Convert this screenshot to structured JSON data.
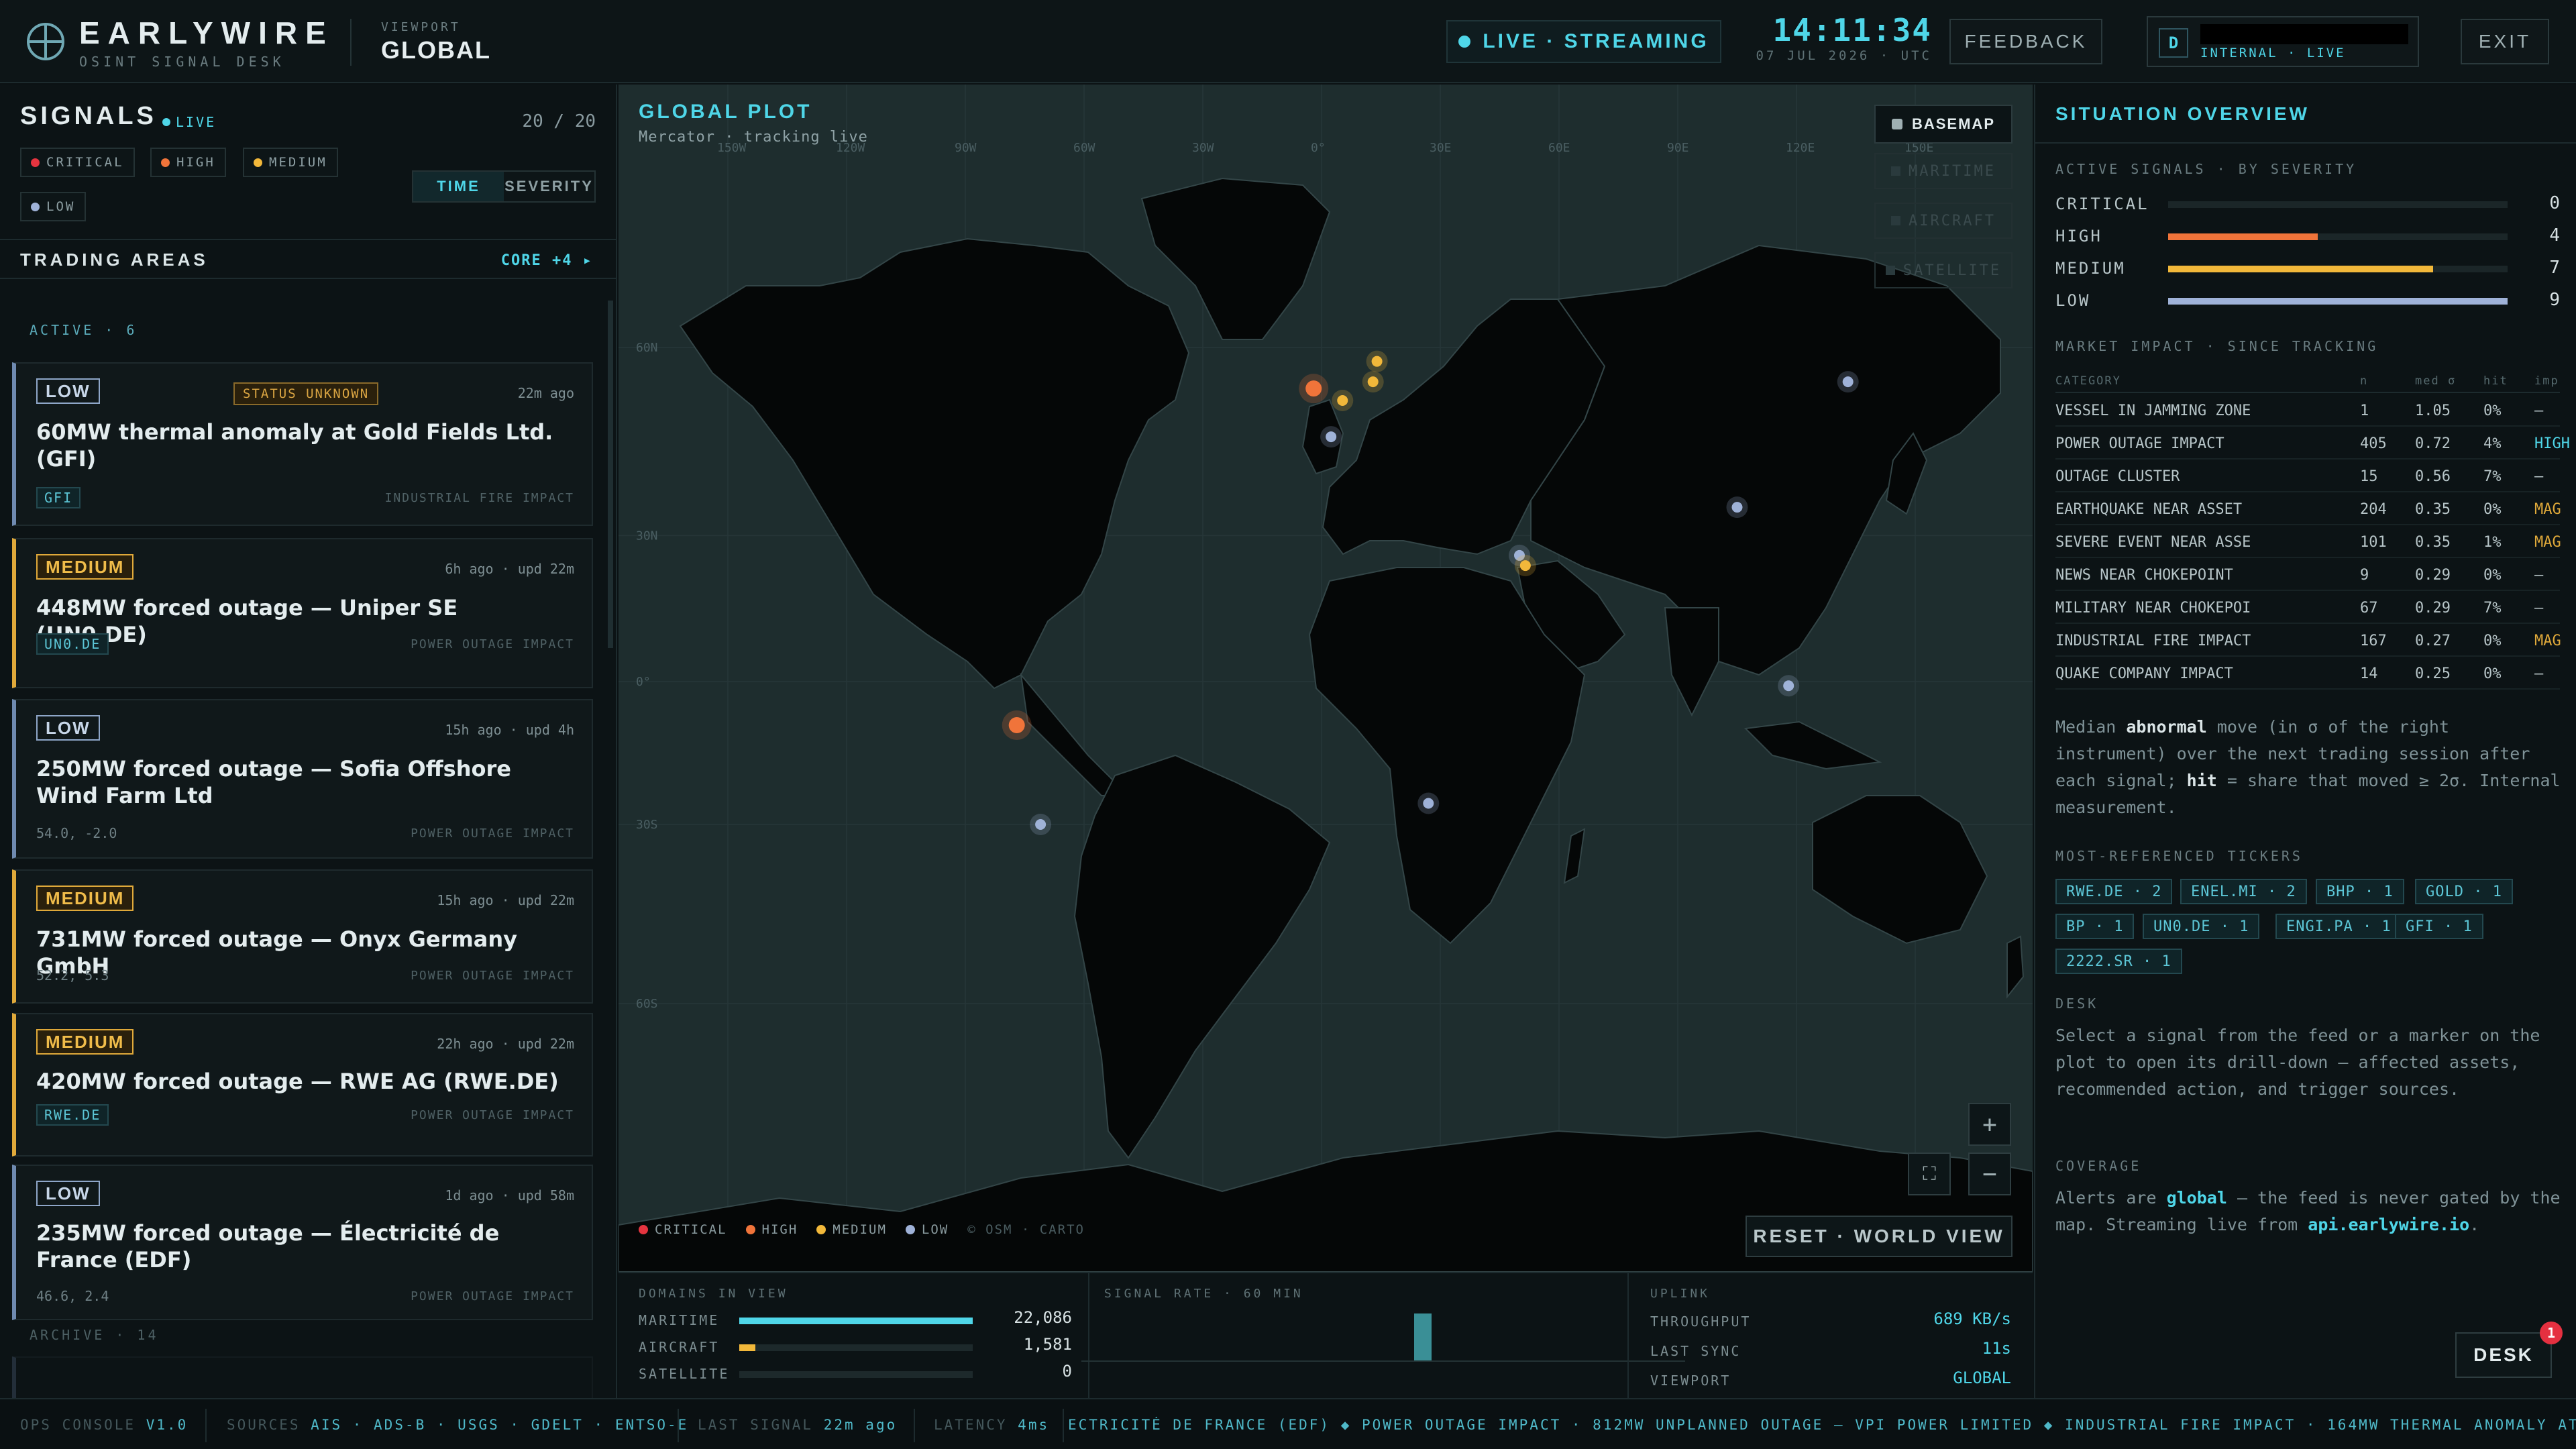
{
  "header": {
    "brand": "EARLYWIRE",
    "brand_sub": "OSINT SIGNAL DESK",
    "viewport_label": "VIEWPORT",
    "viewport_value": "GLOBAL",
    "live_label": "LIVE · STREAMING",
    "clock": "14:11:34",
    "date": "07 JUL 2026 · UTC",
    "feedback_label": "FEEDBACK",
    "user_initial": "D",
    "user_status": "INTERNAL · LIVE",
    "exit_label": "EXIT"
  },
  "colors": {
    "critical": "#e5343f",
    "high": "#f0743a",
    "medium": "#f2b83a",
    "low": "#9fb2d8",
    "accent": "#4fd6e8"
  },
  "signals": {
    "title": "SIGNALS",
    "live": "LIVE",
    "count": "20 / 20",
    "filters": [
      "CRITICAL",
      "HIGH",
      "MEDIUM",
      "LOW"
    ],
    "sort": [
      "TIME",
      "SEVERITY"
    ],
    "trading_title": "TRADING AREAS",
    "trading_link": "CORE +4 ▸",
    "active_label": "ACTIVE · 6",
    "archive_label": "ARCHIVE · 14",
    "cards": [
      {
        "severity": "LOW",
        "status": "STATUS UNKNOWN",
        "time": "22m ago",
        "title": "60MW thermal anomaly at Gold Fields Ltd. (GFI)",
        "ticker": "GFI",
        "type": "INDUSTRIAL FIRE IMPACT"
      },
      {
        "severity": "MEDIUM",
        "time": "6h ago · upd 22m",
        "title": "448MW forced outage — Uniper SE (UN0.DE)",
        "ticker": "UN0.DE",
        "type": "POWER OUTAGE IMPACT"
      },
      {
        "severity": "LOW",
        "time": "15h ago · upd 4h",
        "title": "250MW forced outage — Sofia Offshore Wind Farm Ltd",
        "coord": "54.0, -2.0",
        "type": "POWER OUTAGE IMPACT"
      },
      {
        "severity": "MEDIUM",
        "time": "15h ago · upd 22m",
        "title": "731MW forced outage — Onyx Germany GmbH",
        "coord": "52.2, 5.3",
        "type": "POWER OUTAGE IMPACT"
      },
      {
        "severity": "MEDIUM",
        "time": "22h ago · upd 22m",
        "title": "420MW forced outage — RWE AG (RWE.DE)",
        "ticker": "RWE.DE",
        "type": "POWER OUTAGE IMPACT"
      },
      {
        "severity": "LOW",
        "time": "1d ago · upd 58m",
        "title": "235MW forced outage — Électricité de France (EDF)",
        "coord": "46.6, 2.4",
        "type": "POWER OUTAGE IMPACT"
      }
    ]
  },
  "map": {
    "title": "GLOBAL PLOT",
    "subtitle": "Mercator · tracking live",
    "basemap_label": "BASEMAP",
    "layers": [
      "MARITIME",
      "AIRCRAFT",
      "SATELLITE"
    ],
    "lon_labels": [
      "150W",
      "120W",
      "90W",
      "60W",
      "30W",
      "0°",
      "30E",
      "60E",
      "90E",
      "120E",
      "150E"
    ],
    "lat_labels": [
      "60N",
      "30N",
      "0°",
      "30S",
      "60S"
    ],
    "reset_label": "RESET · WORLD VIEW",
    "zoom_in": "+",
    "zoom_out": "−",
    "legend": [
      "CRITICAL",
      "HIGH",
      "MEDIUM",
      "LOW",
      "© OSM · CARTO"
    ],
    "markers": [
      {
        "lon": -2.0,
        "lat": 54.0,
        "severity": "high"
      },
      {
        "lon": 5.3,
        "lat": 52.2,
        "severity": "medium"
      },
      {
        "lon": 13.0,
        "lat": 55.0,
        "severity": "medium"
      },
      {
        "lon": 14.0,
        "lat": 58.0,
        "severity": "medium"
      },
      {
        "lon": 2.4,
        "lat": 46.6,
        "severity": "low"
      },
      {
        "lon": 50.0,
        "lat": 26.4,
        "severity": "low"
      },
      {
        "lon": 51.5,
        "lat": 24.5,
        "severity": "medium"
      },
      {
        "lon": 105.0,
        "lat": 35.0,
        "severity": "low"
      },
      {
        "lon": 133.0,
        "lat": 55.0,
        "severity": "low"
      },
      {
        "lon": 118.0,
        "lat": -1.0,
        "severity": "low"
      },
      {
        "lon": 27.0,
        "lat": -26.0,
        "severity": "low"
      },
      {
        "lon": -71.0,
        "lat": -30.0,
        "severity": "low"
      },
      {
        "lon": -77.0,
        "lat": -10.0,
        "severity": "high"
      }
    ]
  },
  "domains": {
    "title": "DOMAINS IN VIEW",
    "rows": [
      {
        "label": "MARITIME",
        "value": "22,086",
        "fraction": 1.0
      },
      {
        "label": "AIRCRAFT",
        "value": "1,581",
        "fraction": 0.07
      },
      {
        "label": "SATELLITE",
        "value": "0",
        "fraction": 0.0
      }
    ],
    "rate_title": "SIGNAL RATE · 60 MIN"
  },
  "uplink": {
    "title": "UPLINK",
    "rows": [
      {
        "label": "THROUGHPUT",
        "value": "689 KB/s"
      },
      {
        "label": "LAST SYNC",
        "value": "11s"
      },
      {
        "label": "VIEWPORT",
        "value": "GLOBAL"
      }
    ]
  },
  "overview": {
    "title": "SITUATION OVERVIEW",
    "severity_title": "ACTIVE SIGNALS · BY SEVERITY",
    "severity": [
      {
        "label": "CRITICAL",
        "count": 0,
        "fraction": 0.0
      },
      {
        "label": "HIGH",
        "count": 4,
        "fraction": 0.44
      },
      {
        "label": "MEDIUM",
        "count": 7,
        "fraction": 0.78
      },
      {
        "label": "LOW",
        "count": 9,
        "fraction": 1.0
      }
    ],
    "impact_title": "MARKET IMPACT · SINCE TRACKING",
    "impact_headers": [
      "CATEGORY",
      "n",
      "med σ",
      "hit",
      "imp"
    ],
    "impact_rows": [
      [
        "VESSEL IN JAMMING ZONE",
        "1",
        "1.05",
        "0%",
        "—"
      ],
      [
        "POWER OUTAGE IMPACT",
        "405",
        "0.72",
        "4%",
        "HIGH"
      ],
      [
        "OUTAGE CLUSTER",
        "15",
        "0.56",
        "7%",
        "—"
      ],
      [
        "EARTHQUAKE NEAR ASSET",
        "204",
        "0.35",
        "0%",
        "MAG"
      ],
      [
        "SEVERE EVENT NEAR ASSE",
        "101",
        "0.35",
        "1%",
        "MAG"
      ],
      [
        "NEWS NEAR CHOKEPOINT",
        "9",
        "0.29",
        "0%",
        "—"
      ],
      [
        "MILITARY NEAR CHOKEPOI",
        "67",
        "0.29",
        "7%",
        "—"
      ],
      [
        "INDUSTRIAL FIRE IMPACT",
        "167",
        "0.27",
        "0%",
        "MAG"
      ],
      [
        "QUAKE COMPANY IMPACT",
        "14",
        "0.25",
        "0%",
        "—"
      ]
    ],
    "note_1": "Median ",
    "note_bold": "abnormal",
    "note_2": " move (in σ of the right instrument) over the next trading session after each signal; ",
    "note_hit": "hit",
    "note_3": " = share that moved ≥ 2σ. Internal measurement.",
    "tickers_title": "MOST-REFERENCED TICKERS",
    "tickers": [
      "RWE.DE · 2",
      "ENEL.MI · 2",
      "BHP · 1",
      "GOLD · 1",
      "BP · 1",
      "UN0.DE · 1",
      "ENGI.PA · 1",
      "GFI · 1",
      "2222.SR · 1"
    ],
    "desk_title": "DESK",
    "desk_text": "Select a signal from the feed or a marker on the plot to open its drill-down — affected assets, recommended action, and trigger sources.",
    "coverage_title": "COVERAGE",
    "coverage_1": "Alerts are ",
    "coverage_global": "global",
    "coverage_2": " — the feed is never gated by the map. Streaming live from ",
    "coverage_api": "api.earlywire.io",
    "coverage_3": ".",
    "desk_button": "DESK",
    "desk_badge": "1"
  },
  "footer": {
    "console": "OPS CONSOLE",
    "version": "V1.0",
    "sources_label": "SOURCES",
    "sources": "AIS · ADS-B · USGS · GDELT · ENTSO-E",
    "last_label": "LAST SIGNAL",
    "last_value": "22m ago",
    "latency_label": "LATENCY",
    "latency_value": "4ms",
    "ticker": "ECTRICITÉ DE FRANCE (EDF) ◆ POWER OUTAGE IMPACT · 812MW UNPLANNED OUTAGE — VPI POWER LIMITED ◆ INDUSTRIAL FIRE IMPACT · 164MW THERMAL ANOMALY AT DAS ISLAND LN"
  }
}
